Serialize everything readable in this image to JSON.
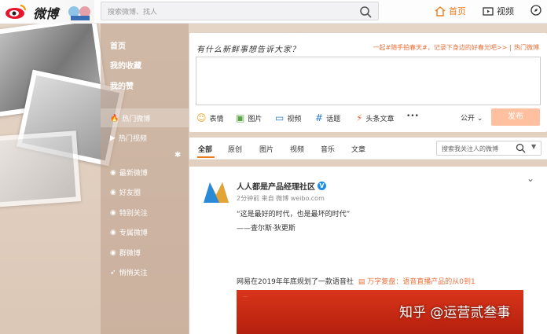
{
  "header": {
    "logo_text": "微博",
    "search_placeholder": "搜索微博、找人",
    "nav": [
      {
        "label": "首页",
        "icon": "home-icon",
        "active": true
      },
      {
        "label": "视频",
        "icon": "video-icon",
        "active": false
      }
    ]
  },
  "sidebar": {
    "items": [
      {
        "label": "首页",
        "icon": null
      },
      {
        "label": "我的收藏",
        "icon": null
      },
      {
        "label": "我的赞",
        "icon": null
      },
      {
        "label": "热门微博",
        "icon": "fire-icon",
        "active": true
      },
      {
        "label": "热门视频",
        "icon": "video-icon"
      },
      {
        "label": "最新微博",
        "icon": "circle-icon"
      },
      {
        "label": "好友圈",
        "icon": "heart-icon"
      },
      {
        "label": "特别关注",
        "icon": "star-icon"
      },
      {
        "label": "专属微博",
        "icon": "circle-icon"
      },
      {
        "label": "群微博",
        "icon": "group-icon"
      },
      {
        "label": "悄悄关注",
        "icon": "eye-icon"
      }
    ]
  },
  "composer": {
    "prompt": "有什么新鲜事想告诉大家？",
    "hot_topic": "一起#随手拍春天#，记录下身边的好春光吧>>",
    "hot_topic_link": "热门微博",
    "tools": [
      {
        "label": "表情",
        "icon": "smile-icon"
      },
      {
        "label": "图片",
        "icon": "image-icon"
      },
      {
        "label": "视频",
        "icon": "video-icon"
      },
      {
        "label": "话题",
        "icon": "hash-icon"
      },
      {
        "label": "头条文章",
        "icon": "lightning-icon"
      },
      {
        "label": "•••",
        "icon": "more-icon"
      }
    ],
    "visibility": "公开",
    "publish_label": "发布"
  },
  "feed_tabs": {
    "tabs": [
      "全部",
      "原创",
      "图片",
      "视频",
      "音乐",
      "文章"
    ],
    "active": "全部",
    "search_placeholder": "搜索我关注人的微博"
  },
  "post": {
    "author": "人人都是产品经理社区",
    "meta": "2分钟前 来自 微博 weibo.com",
    "lines": [
      "“这是最好的时代，也是最坏的时代”",
      "——查尔斯·狄更斯"
    ],
    "sub_text": "网易在2019年年底规划了一款语音社",
    "sub_link": "万字复盘：语音直播产品的从0到1",
    "image_caption": "…"
  },
  "watermark": "知乎 @运营贰叁事",
  "colors": {
    "accent": "#ea7c1c",
    "publish_disabled": "#ffc09f",
    "link": "#ea6f3a",
    "verified": "#1c8de6"
  }
}
